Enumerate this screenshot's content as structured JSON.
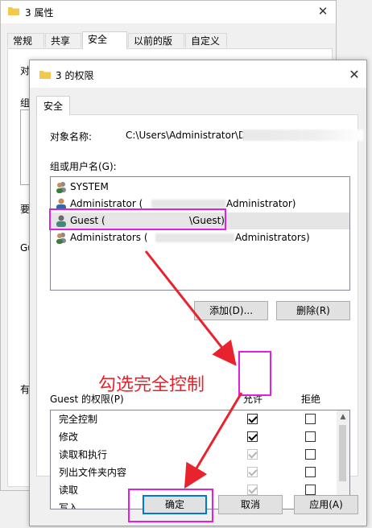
{
  "back_window": {
    "title": "3 属性",
    "tabs": [
      "常规",
      "共享",
      "安全",
      "以前的版本",
      "自定义"
    ],
    "active_tab": "安全",
    "fragments": [
      "对",
      "组",
      "要",
      "Gu",
      "有"
    ]
  },
  "dialog": {
    "title": "3 的权限",
    "tab": "安全",
    "object_label": "对象名称:",
    "object_value": "C:\\Users\\Administrator\\Des",
    "group_label": "组或用户名(G):",
    "users": [
      {
        "name": "SYSTEM",
        "suffix": ""
      },
      {
        "name": "Administrator (",
        "suffix": "Administrator)"
      },
      {
        "name": "Guest (",
        "suffix": "\\Guest)"
      },
      {
        "name": "Administrators (",
        "suffix": "Administrators)"
      }
    ],
    "selected_user_index": 2,
    "add_button": "添加(D)...",
    "remove_button": "删除(R)",
    "perm_label": "Guest 的权限(P)",
    "allow_label": "允许",
    "deny_label": "拒绝",
    "permissions": [
      {
        "name": "完全控制",
        "allow": true,
        "deny": false,
        "allow_disabled": false
      },
      {
        "name": "修改",
        "allow": true,
        "deny": false,
        "allow_disabled": false
      },
      {
        "name": "读取和执行",
        "allow": true,
        "deny": false,
        "allow_disabled": true
      },
      {
        "name": "列出文件夹内容",
        "allow": true,
        "deny": false,
        "allow_disabled": true
      },
      {
        "name": "读取",
        "allow": true,
        "deny": false,
        "allow_disabled": true
      },
      {
        "name": "写入",
        "allow": false,
        "deny": false,
        "allow_disabled": false
      }
    ],
    "ok_button": "确定",
    "cancel_button": "取消",
    "apply_button": "应用(A)"
  },
  "annotation": {
    "text": "勾选完全控制",
    "highlight_color": "#e020e0",
    "arrow_color": "#e8232e"
  },
  "colors": {
    "selection": "#e5e5e5",
    "default_button_border": "#0078d7",
    "folder": "#f2c94c"
  }
}
